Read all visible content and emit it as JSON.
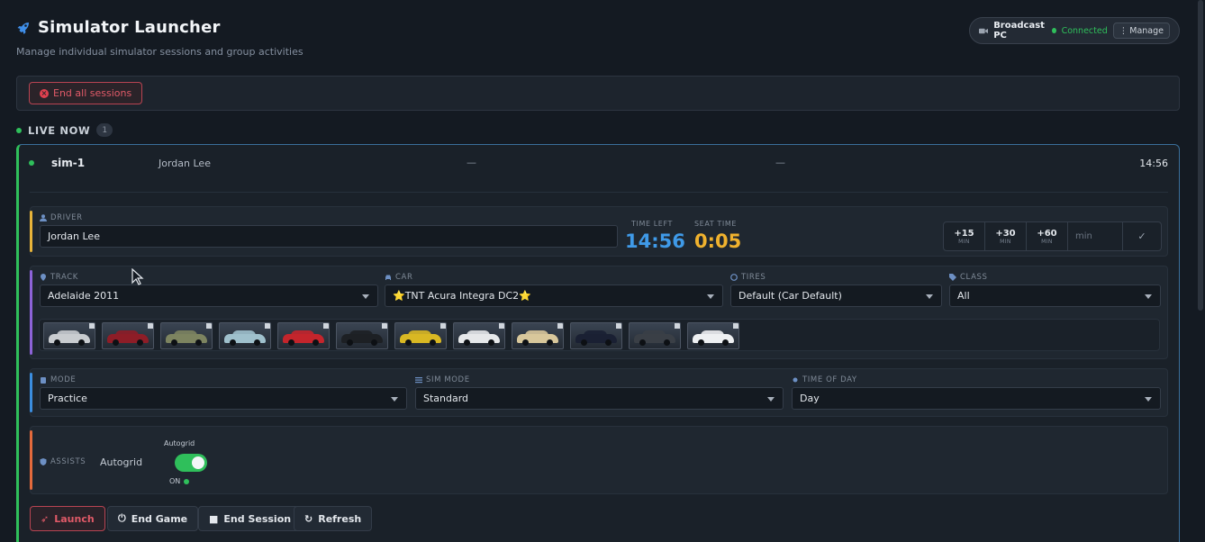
{
  "header": {
    "title": "Simulator Launcher",
    "subtitle": "Manage individual simulator sessions and group activities",
    "broadcast": {
      "name": "Broadcast PC",
      "status": "Connected",
      "manage_label": "Manage"
    }
  },
  "actions": {
    "end_all_label": "End all sessions"
  },
  "live": {
    "label": "LIVE NOW",
    "count": "1"
  },
  "session": {
    "sim": "sim-1",
    "driver": "Jordan Lee",
    "col3": "—",
    "col4": "—",
    "time": "14:56",
    "driver_label": "DRIVER",
    "driver_value": "Jordan Lee",
    "time_left_label": "TIME LEFT",
    "time_left": "14:56",
    "seat_time_label": "SEAT TIME",
    "seat_time": "0:05",
    "increments": [
      {
        "value": "+15",
        "unit": "MIN"
      },
      {
        "value": "+30",
        "unit": "MIN"
      },
      {
        "value": "+60",
        "unit": "MIN"
      }
    ],
    "min_placeholder": "min",
    "track_label": "TRACK",
    "track_value": "Adelaide 2011",
    "car_label": "CAR",
    "car_value": "⭐TNT Acura Integra DC2⭐",
    "tires_label": "TIRES",
    "tires_value": "Default (Car Default)",
    "class_label": "CLASS",
    "class_value": "All",
    "mode_label": "MODE",
    "mode_value": "Practice",
    "sim_mode_label": "SIM MODE",
    "sim_mode_value": "Standard",
    "tod_label": "TIME OF DAY",
    "tod_value": "Day",
    "assists_label": "ASSISTS",
    "assists_value": "Autogrid",
    "autogrid_label": "Autogrid",
    "autogrid_state": "ON",
    "skins": [
      {
        "color": "#c9ccd0"
      },
      {
        "color": "#8e1d27"
      },
      {
        "color": "#7d8460"
      },
      {
        "color": "#9fc0cc"
      },
      {
        "color": "#c4252c"
      },
      {
        "color": "#1d2024"
      },
      {
        "color": "#d9b823"
      },
      {
        "color": "#e6e8ea"
      },
      {
        "color": "#d8c79b"
      },
      {
        "color": "#1a2033"
      },
      {
        "color": "#3a3f46"
      },
      {
        "color": "#eef0f2"
      }
    ],
    "buttons": {
      "launch": "Launch",
      "end_game": "End Game",
      "end_session": "End Session",
      "refresh": "Refresh"
    }
  },
  "colors": {
    "accent_green": "#2fbf5b",
    "accent_red": "#e05a68",
    "time_left": "#3f9ae8",
    "seat_time": "#f0b22e"
  }
}
